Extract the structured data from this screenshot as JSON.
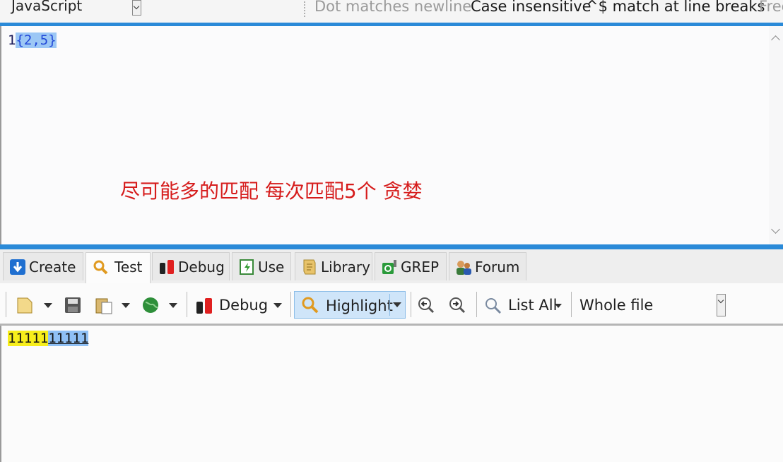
{
  "options_bar": {
    "flavor": "JavaScript",
    "dot_matches_newline": "Dot matches newline",
    "case_insensitive": "Case insensitive",
    "caret_dollar": "^$ match at line breaks",
    "free_spacing": "Free"
  },
  "regex": {
    "plain": "1",
    "quantifier": "{2,5}"
  },
  "annotation": "尽可能多的匹配 每次匹配5个 贪婪",
  "tabs": [
    {
      "label": "Create",
      "icon": "create-icon"
    },
    {
      "label": "Test",
      "icon": "search-icon"
    },
    {
      "label": "Debug",
      "icon": "bug-icon"
    },
    {
      "label": "Use",
      "icon": "use-icon"
    },
    {
      "label": "Library",
      "icon": "library-icon"
    },
    {
      "label": "GREP",
      "icon": "grep-icon"
    },
    {
      "label": "Forum",
      "icon": "forum-icon"
    }
  ],
  "active_tab": "Test",
  "toolbar": {
    "debug_label": "Debug",
    "highlight_label": "Highlight",
    "list_all_label": "List All",
    "scope_value": "Whole file"
  },
  "test_subject": {
    "match1": "11111",
    "match2": "11111"
  },
  "colors": {
    "accent": "#2a8ad8",
    "match_yellow": "#f7ee1c",
    "match_blue": "#8fc0f5",
    "annotation_red": "#d61c1c"
  }
}
